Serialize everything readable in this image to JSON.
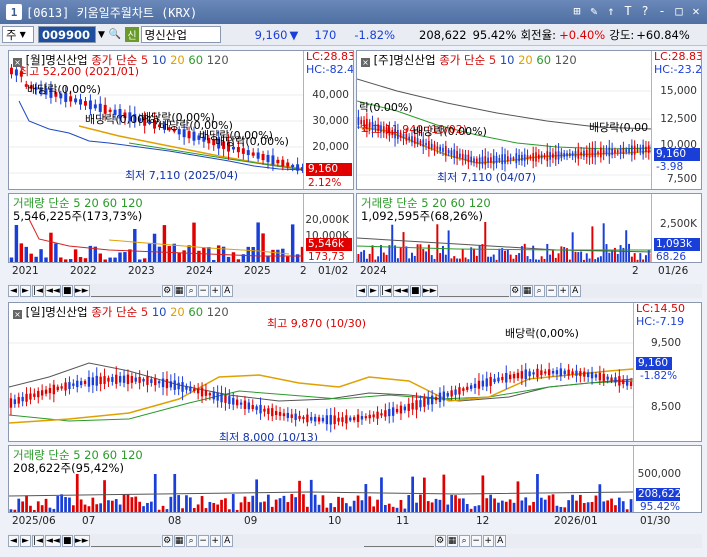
{
  "window": {
    "number": "1",
    "title": "[0613] 키움일주월차트 (KRX)",
    "buttons": [
      "⊞",
      "✎",
      "↑",
      "T",
      "?",
      "‐",
      "□",
      "✕"
    ]
  },
  "toolbar": {
    "market": "주",
    "code": "009900",
    "badge": "신",
    "name": "명신산업",
    "price": "9,160",
    "change_arrow": "▼",
    "change": "170",
    "change_pct": "-1.82%",
    "volume": "208,622",
    "volume_ratio": "95.42%",
    "turnover_label": "회전율:",
    "turnover": "+0.40%",
    "strength_label": "강도:",
    "strength": "+60.84%"
  },
  "panels": {
    "monthly": {
      "title_code": "[월]명신산업",
      "ma_label": "종가 단순",
      "ma_periods": [
        "5",
        "10",
        "20",
        "60",
        "120"
      ],
      "lc": "LC:28.83",
      "hc": "HC:-82.4",
      "y_labels": [
        "40,000",
        "30,000",
        "20,000",
        "10,000"
      ],
      "price_chip": "9,160",
      "pct_chip": "2.12%",
      "high_ann": "최고 52,200 (2021/01)",
      "low_ann": "최저 7,110 (2025/04)",
      "div_anns": [
        "배당락(0,00%)",
        "배당락(0,00%)",
        "배당락(0,00%)",
        "배당락(0,00%)",
        "배당락(0,00%)",
        "배당락(0,00%)"
      ],
      "vol_title": "거래량 단순 5 20 60 120",
      "vol_value": "5,546,225주(173,73%)",
      "vol_y": [
        "20,000K",
        "10,000K"
      ],
      "vol_chip1": "5,546k",
      "vol_chip2": "173,73",
      "dates": [
        "2021",
        "2022",
        "2023",
        "2024",
        "2025",
        "2"
      ],
      "date_end": "01/02"
    },
    "weekly": {
      "title_code": "[주]명신산업",
      "ma_label": "종가 단순",
      "ma_periods": [
        "5",
        "10",
        "20",
        "60",
        "120"
      ],
      "lc": "LC:28.83",
      "hc": "HC:-23.2",
      "y_labels": [
        "15,000",
        "12,500",
        "10,000",
        "7,500"
      ],
      "price_chip": "9,160",
      "pct_chip": "-3.98",
      "high_ann": "최고 11,940 (10/02)",
      "low_ann": "최저 7,110 (04/07)",
      "div_anns": [
        "락(0.00%)",
        "배당락(0.00%)",
        "배당락(0,00"
      ],
      "vol_title": "거래량 단순 5 20 60 120",
      "vol_value": "1,092,595주(68,26%)",
      "vol_y": [
        "2,500K"
      ],
      "vol_chip1": "1,093k",
      "vol_chip2": "68.26",
      "dates": [
        "2024",
        "2"
      ],
      "date_end": "01/26"
    },
    "daily": {
      "title_code": "[일]명신산업",
      "ma_label": "종가 단순",
      "ma_periods": [
        "5",
        "10",
        "20",
        "60",
        "120"
      ],
      "lc": "LC:14.50",
      "hc": "HC:-7.19",
      "y_labels": [
        "9,500",
        "8,500"
      ],
      "price_chip": "9,160",
      "pct_chip": "-1.82%",
      "high_ann": "최고 9,870 (10/30)",
      "low_ann": "최저 8,000 (10/13)",
      "div_anns": [
        "배당락(0,00%)"
      ],
      "vol_title": "거래량 단순 5 20 60 120",
      "vol_value": "208,622주(95,42%)",
      "vol_y": [
        "500,000"
      ],
      "vol_chip1": "208,622",
      "vol_chip2": "95.42%",
      "dates": [
        "2025/06",
        "07",
        "08",
        "09",
        "10",
        "11",
        "12",
        "2026/01"
      ],
      "date_end": "01/30"
    }
  },
  "colors": {
    "up": "#e00000",
    "down": "#1a3fd8",
    "ma5": "#d92020",
    "ma10": "#1f48c0",
    "ma20": "#e0a000",
    "ma60": "#2a9a2a",
    "ma120": "#555555"
  }
}
